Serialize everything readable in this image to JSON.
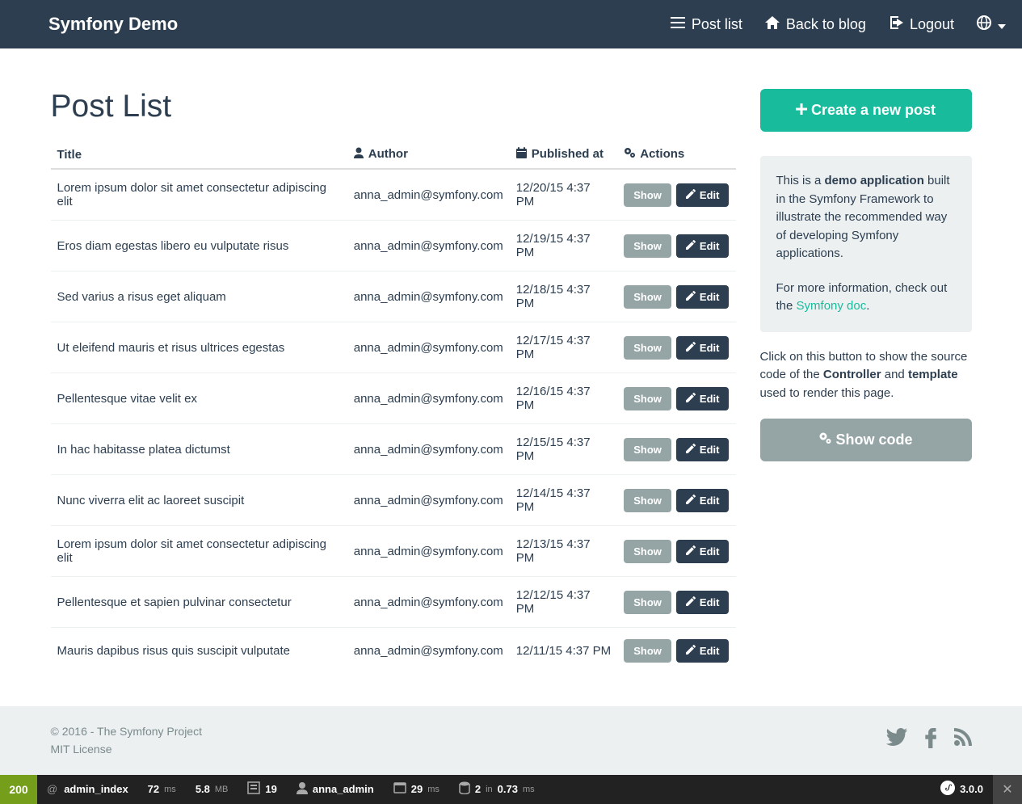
{
  "nav": {
    "brand": "Symfony Demo",
    "items": [
      {
        "label": "Post list"
      },
      {
        "label": "Back to blog"
      },
      {
        "label": "Logout"
      }
    ]
  },
  "page": {
    "title": "Post List",
    "columns": {
      "title": "Title",
      "author": "Author",
      "published": "Published at",
      "actions": "Actions"
    },
    "rows": [
      {
        "title": "Lorem ipsum dolor sit amet consectetur adipiscing elit",
        "author": "anna_admin@symfony.com",
        "published": "12/20/15 4:37 PM"
      },
      {
        "title": "Eros diam egestas libero eu vulputate risus",
        "author": "anna_admin@symfony.com",
        "published": "12/19/15 4:37 PM"
      },
      {
        "title": "Sed varius a risus eget aliquam",
        "author": "anna_admin@symfony.com",
        "published": "12/18/15 4:37 PM"
      },
      {
        "title": "Ut eleifend mauris et risus ultrices egestas",
        "author": "anna_admin@symfony.com",
        "published": "12/17/15 4:37 PM"
      },
      {
        "title": "Pellentesque vitae velit ex",
        "author": "anna_admin@symfony.com",
        "published": "12/16/15 4:37 PM"
      },
      {
        "title": "In hac habitasse platea dictumst",
        "author": "anna_admin@symfony.com",
        "published": "12/15/15 4:37 PM"
      },
      {
        "title": "Nunc viverra elit ac laoreet suscipit",
        "author": "anna_admin@symfony.com",
        "published": "12/14/15 4:37 PM"
      },
      {
        "title": "Lorem ipsum dolor sit amet consectetur adipiscing elit",
        "author": "anna_admin@symfony.com",
        "published": "12/13/15 4:37 PM"
      },
      {
        "title": "Pellentesque et sapien pulvinar consectetur",
        "author": "anna_admin@symfony.com",
        "published": "12/12/15 4:37 PM"
      },
      {
        "title": "Mauris dapibus risus quis suscipit vulputate",
        "author": "anna_admin@symfony.com",
        "published": "12/11/15 4:37 PM"
      }
    ],
    "actions": {
      "show": "Show",
      "edit": "Edit"
    }
  },
  "sidebar": {
    "create": "Create a new post",
    "well_p1_a": "This is a ",
    "well_p1_b": "demo application",
    "well_p1_c": " built in the Symfony Framework to illustrate the recommended way of developing Symfony applications.",
    "well_p2_a": "For more information, check out the ",
    "well_p2_b": "Symfony doc",
    "well_p2_c": ".",
    "side_a": "Click on this button to show the source code of the ",
    "side_b": "Controller",
    "side_c": " and ",
    "side_d": "template",
    "side_e": " used to render this page.",
    "show_code": "Show code"
  },
  "footer": {
    "copyright": "© 2016 - The Symfony Project",
    "license": "MIT License"
  },
  "toolbar": {
    "status": "200",
    "route_at": "@",
    "route": "admin_index",
    "time_n": "72",
    "time_u": "ms",
    "mem_n": "5.8",
    "mem_u": "MB",
    "forms": "19",
    "user": "anna_admin",
    "twig_n": "29",
    "twig_u": "ms",
    "db_a": "2",
    "db_b": "in",
    "db_c": "0.73",
    "db_d": "ms",
    "version": "3.0.0"
  }
}
